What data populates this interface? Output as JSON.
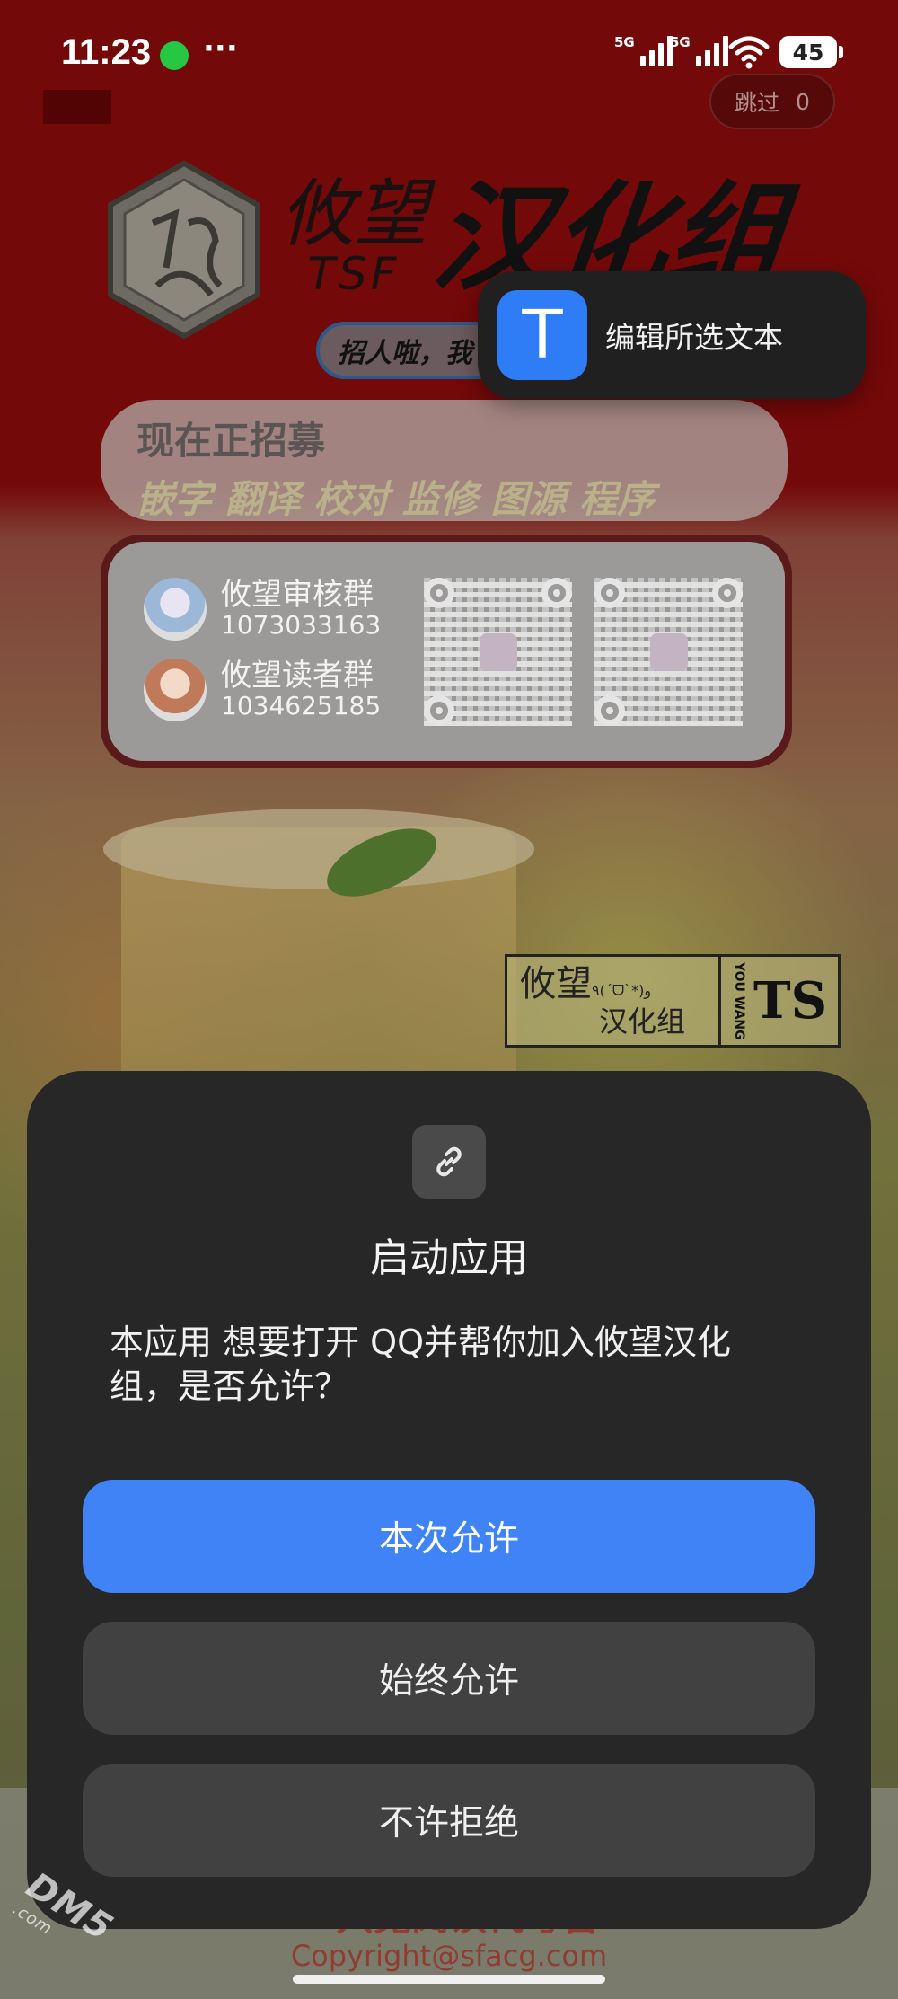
{
  "status_bar": {
    "time": "11:23",
    "more": "···",
    "sim1_label": "5G",
    "sim2_label": "5G",
    "battery": "45"
  },
  "splash": {
    "skip_label": "跳过",
    "skip_count": "0",
    "brand_name": "攸望",
    "brand_latin": "TSF",
    "brand_group": "汉化组",
    "recruit_pill": "招人啦，我",
    "roles_title": "现在正招募",
    "roles_list": "嵌字 翻译 校对 监修 图源 程序",
    "groups": [
      {
        "name": "攸望审核群",
        "number": "1073033163"
      },
      {
        "name": "攸望读者群",
        "number": "1034625185"
      }
    ],
    "stamp_top": "攸望",
    "stamp_emoticon": "٩(ˊᗜˋ*)و",
    "stamp_bottom": "汉化组",
    "stamp_vertical": "YOU WANG",
    "stamp_mark": "TS",
    "footer_line1": "一只兔阅读代号吉",
    "footer_line2": "Copyright@sfacg.com"
  },
  "popover": {
    "icon_letter": "T",
    "label": "编辑所选文本"
  },
  "dialog": {
    "icon": "link-icon",
    "title": "启动应用",
    "message": "本应用 想要打开 QQ并帮你加入攸望汉化组，是否允许？",
    "buttons": {
      "allow_once": "本次允许",
      "allow_always": "始终允许",
      "deny": "不许拒绝"
    }
  },
  "watermark": {
    "main": "DM5",
    "sub": ".com"
  },
  "colors": {
    "primary_button": "#3f83f7",
    "dialog_bg": "#272727",
    "secondary_button": "#414141",
    "splash_red": "#8e0b0b"
  }
}
